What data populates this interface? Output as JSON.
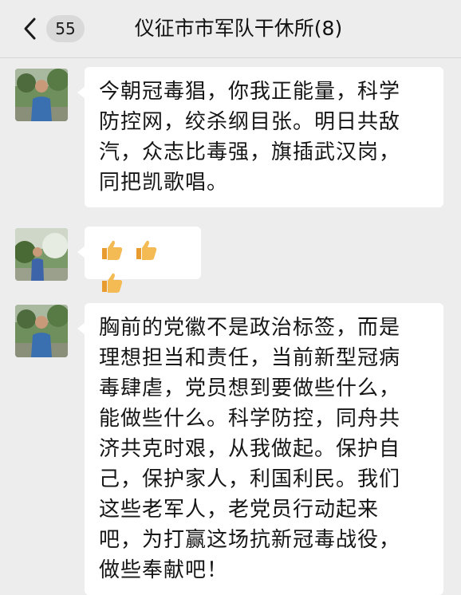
{
  "header": {
    "unread_count": "55",
    "title": "仪征市市军队干休所(8)"
  },
  "messages": [
    {
      "lines": [
        "今朝冠毒猖，你我正能量，科学",
        "防控网，绞杀纲目张。明日共敌",
        "汽，众志比毒强，旗插武汉岗，",
        "同把凯歌唱。"
      ]
    },
    {
      "emoji": "👍👍👍",
      "emoji_icons": [
        "thumbs-up-icon",
        "thumbs-up-icon",
        "thumbs-up-icon"
      ]
    },
    {
      "lines": [
        "胸前的党徽不是政治标签，而是",
        "理想担当和责任，当前新型冠病",
        "毒肆虐，党员想到要做些什么，",
        "能做些什么。科学防控，同舟共",
        "济共克时艰，从我做起。保护自",
        "己，保护家人，利国利民。我们",
        "这些老军人，老党员行动起来",
        "吧，为打赢这场抗新冠毒战役，",
        "做些奉献吧！"
      ]
    }
  ],
  "colors": {
    "background": "#ededed",
    "bubble": "#ffffff",
    "thumb": "#f2b24c"
  }
}
